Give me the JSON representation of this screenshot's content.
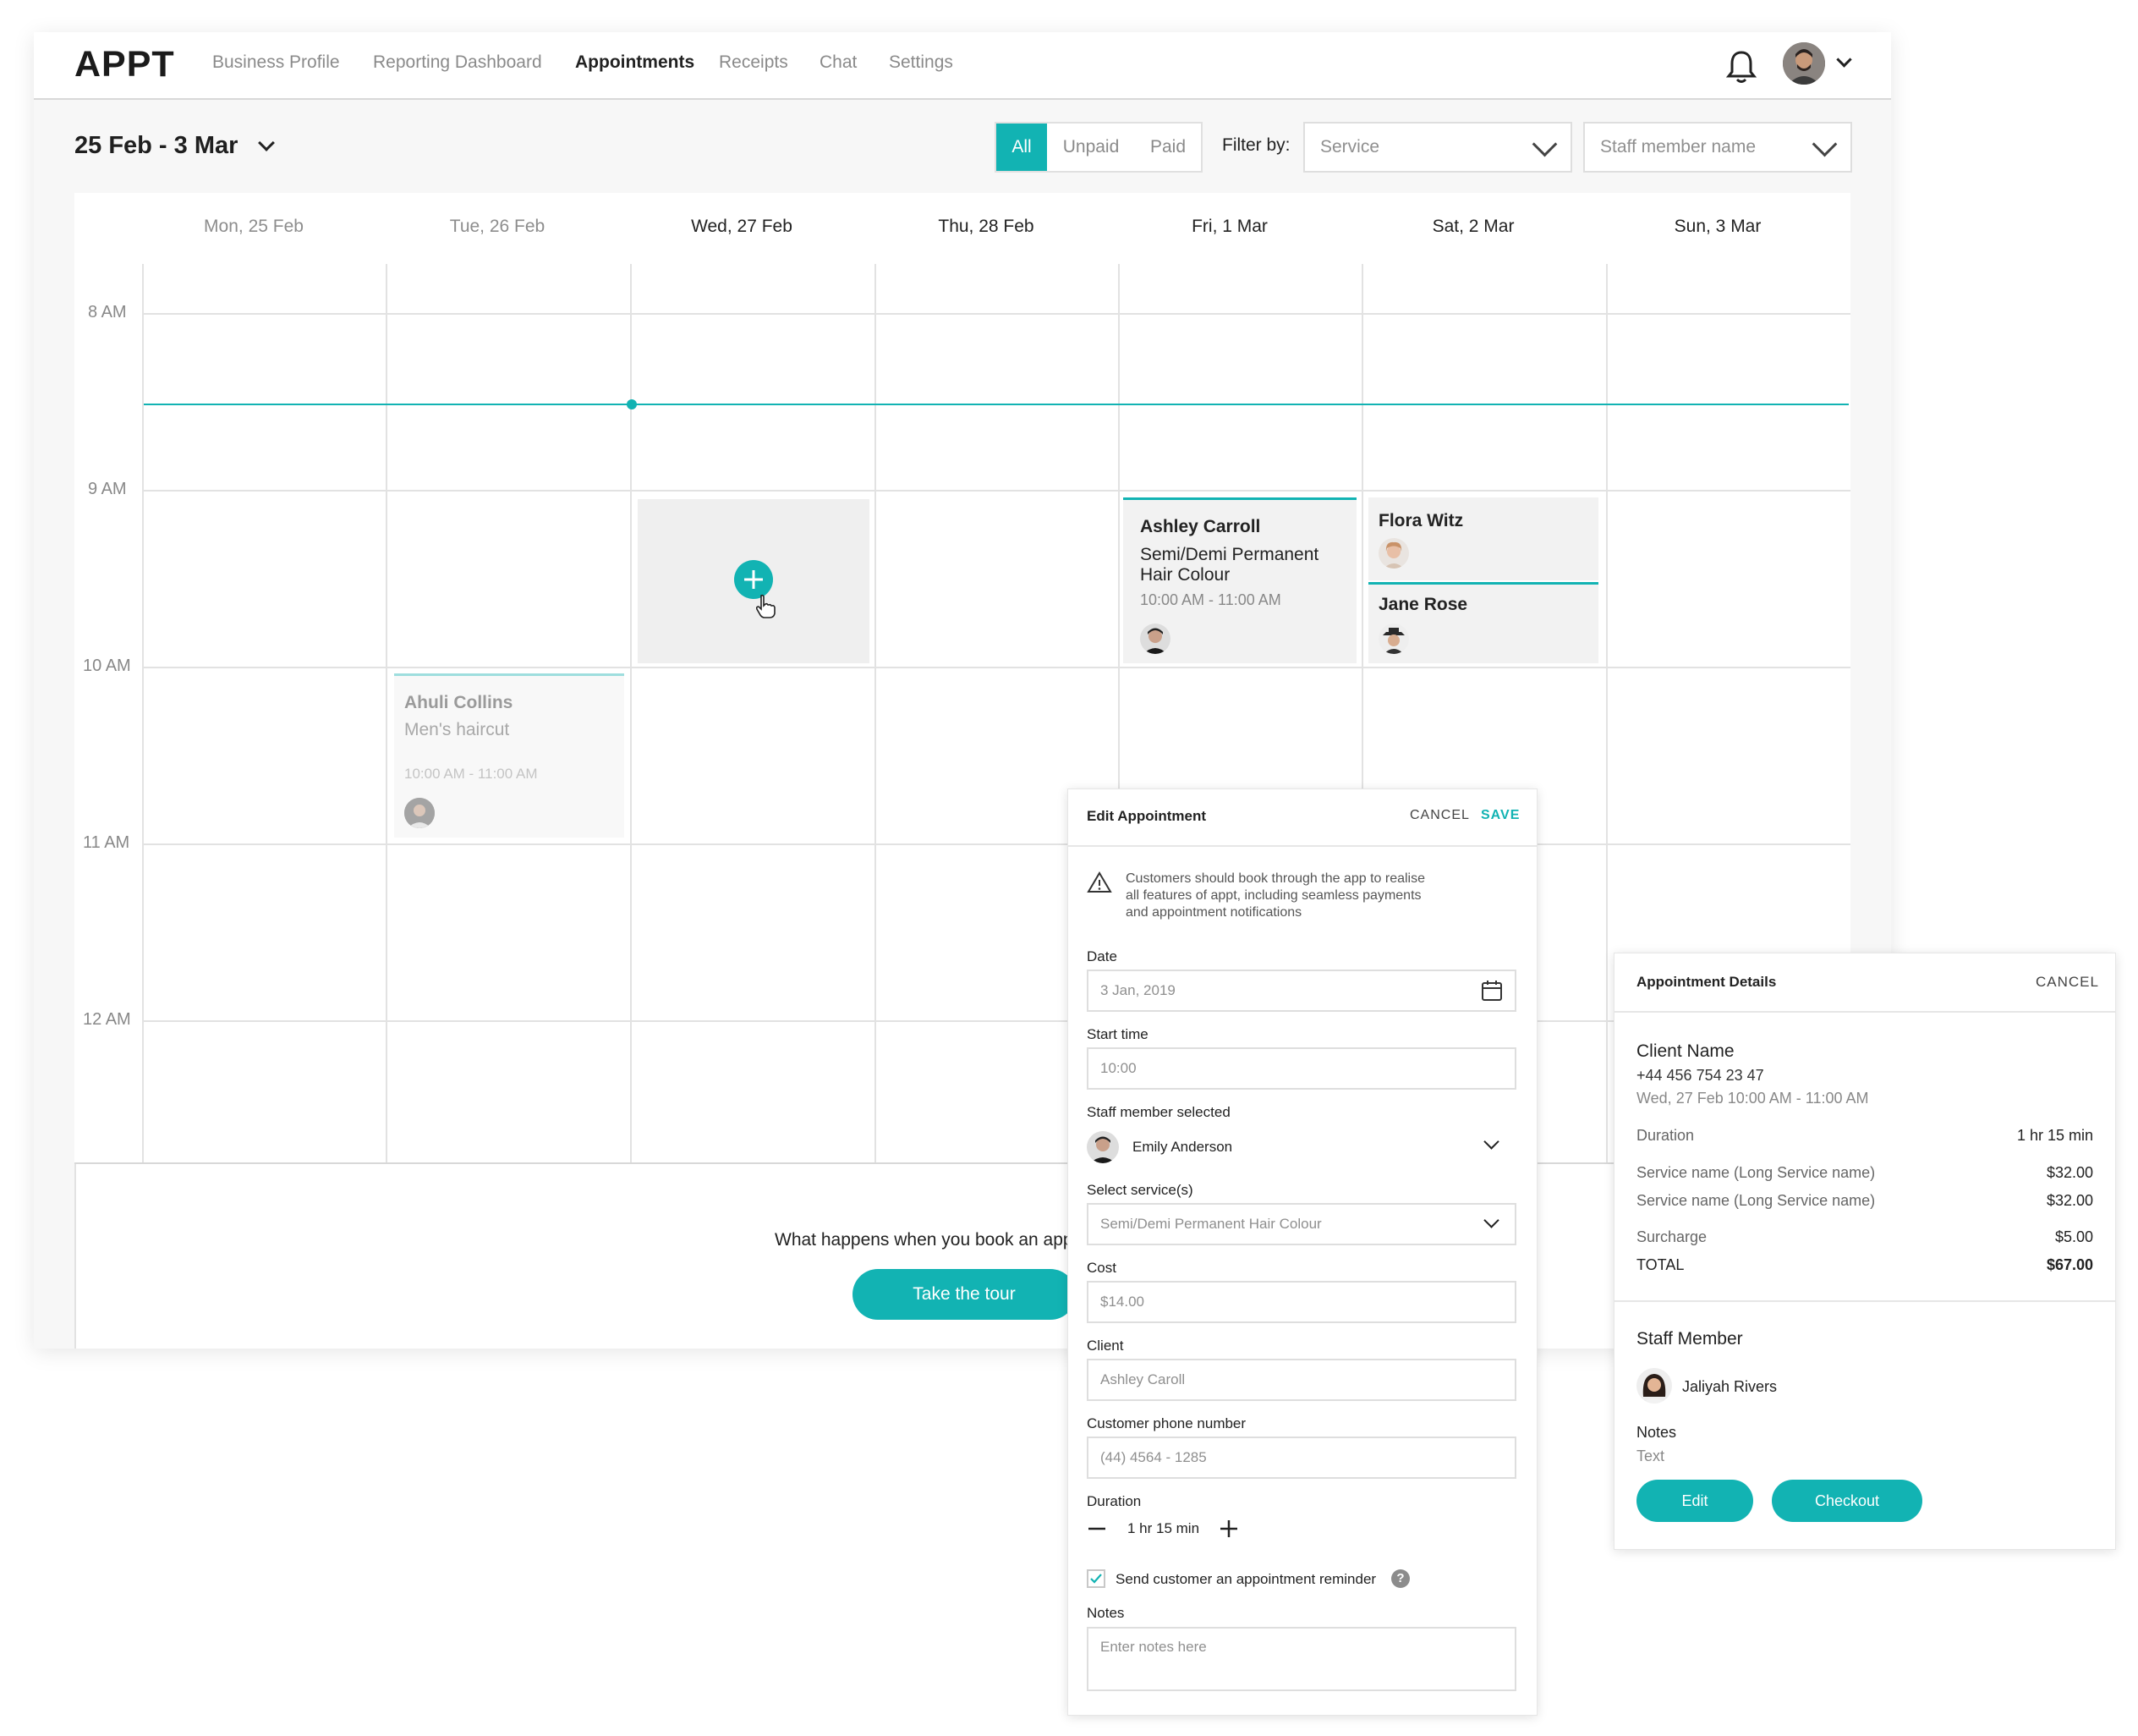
{
  "header": {
    "logo": "APPT",
    "nav": [
      "Business Profile",
      "Reporting Dashboard",
      "Appointments",
      "Receipts",
      "Chat",
      "Settings"
    ],
    "active_nav": "Appointments"
  },
  "toolbar": {
    "date_range": "25 Feb - 3 Mar",
    "segments": [
      "All",
      "Unpaid",
      "Paid"
    ],
    "active_segment": "All",
    "filter_label": "Filter by:",
    "service_placeholder": "Service",
    "staff_placeholder": "Staff member name"
  },
  "calendar": {
    "days": [
      "Mon, 25 Feb",
      "Tue, 26 Feb",
      "Wed, 27 Feb",
      "Thu, 28 Feb",
      "Fri, 1 Mar",
      "Sat, 2 Mar",
      "Sun, 3 Mar"
    ],
    "times": [
      "8 AM",
      "9 AM",
      "10 AM",
      "11 AM",
      "12 AM"
    ],
    "appointments": {
      "ahuli": {
        "name": "Ahuli Collins",
        "service": "Men's haircut",
        "time": "10:00 AM - 11:00 AM"
      },
      "ashley": {
        "name": "Ashley Carroll",
        "service_line1": "Semi/Demi Permanent",
        "service_line2": "Hair Colour",
        "time": "10:00 AM - 11:00 AM"
      },
      "flora": {
        "name": "Flora Witz"
      },
      "jane": {
        "name": "Jane Rose"
      }
    },
    "tour_text": "What happens when you book an app",
    "tour_button": "Take the tour"
  },
  "edit_panel": {
    "title": "Edit Appointment",
    "cancel": "CANCEL",
    "save": "SAVE",
    "warning_line1": "Customers should book through the app to realise",
    "warning_line2": "all features of appt, including seamless payments",
    "warning_line3": "and appointment notifications",
    "date_label": "Date",
    "date_value": "3 Jan, 2019",
    "start_label": "Start time",
    "start_value": "10:00",
    "staff_label": "Staff member selected",
    "staff_value": "Emily Anderson",
    "service_label": "Select service(s)",
    "service_value": "Semi/Demi Permanent Hair Colour",
    "cost_label": "Cost",
    "cost_value": "$14.00",
    "client_label": "Client",
    "client_value": "Ashley Caroll",
    "phone_label": "Customer phone number",
    "phone_value": "(44) 4564 - 1285",
    "duration_label": "Duration",
    "duration_value": "1 hr 15 min",
    "reminder_label": "Send customer an appointment reminder",
    "reminder_checked": true,
    "notes_label": "Notes",
    "notes_placeholder": "Enter notes here"
  },
  "details_panel": {
    "title": "Appointment Details",
    "cancel": "CANCEL",
    "client_name": "Client Name",
    "phone": "+44 456 754 23 47",
    "when": "Wed, 27 Feb 10:00 AM - 11:00 AM",
    "duration_label": "Duration",
    "duration_value": "1 hr 15 min",
    "service1_label": "Service name (Long Service name)",
    "service1_value": "$32.00",
    "service2_label": "Service name (Long Service name)",
    "service2_value": "$32.00",
    "surcharge_label": "Surcharge",
    "surcharge_value": "$5.00",
    "total_label": "TOTAL",
    "total_value": "$67.00",
    "staff_heading": "Staff Member",
    "staff_name": "Jaliyah Rivers",
    "notes_heading": "Notes",
    "notes_value": "Text",
    "edit_button": "Edit",
    "checkout_button": "Checkout"
  },
  "colors": {
    "accent": "#12b3b3",
    "background": "#f7f7f7",
    "grid": "#e2e2e2"
  }
}
